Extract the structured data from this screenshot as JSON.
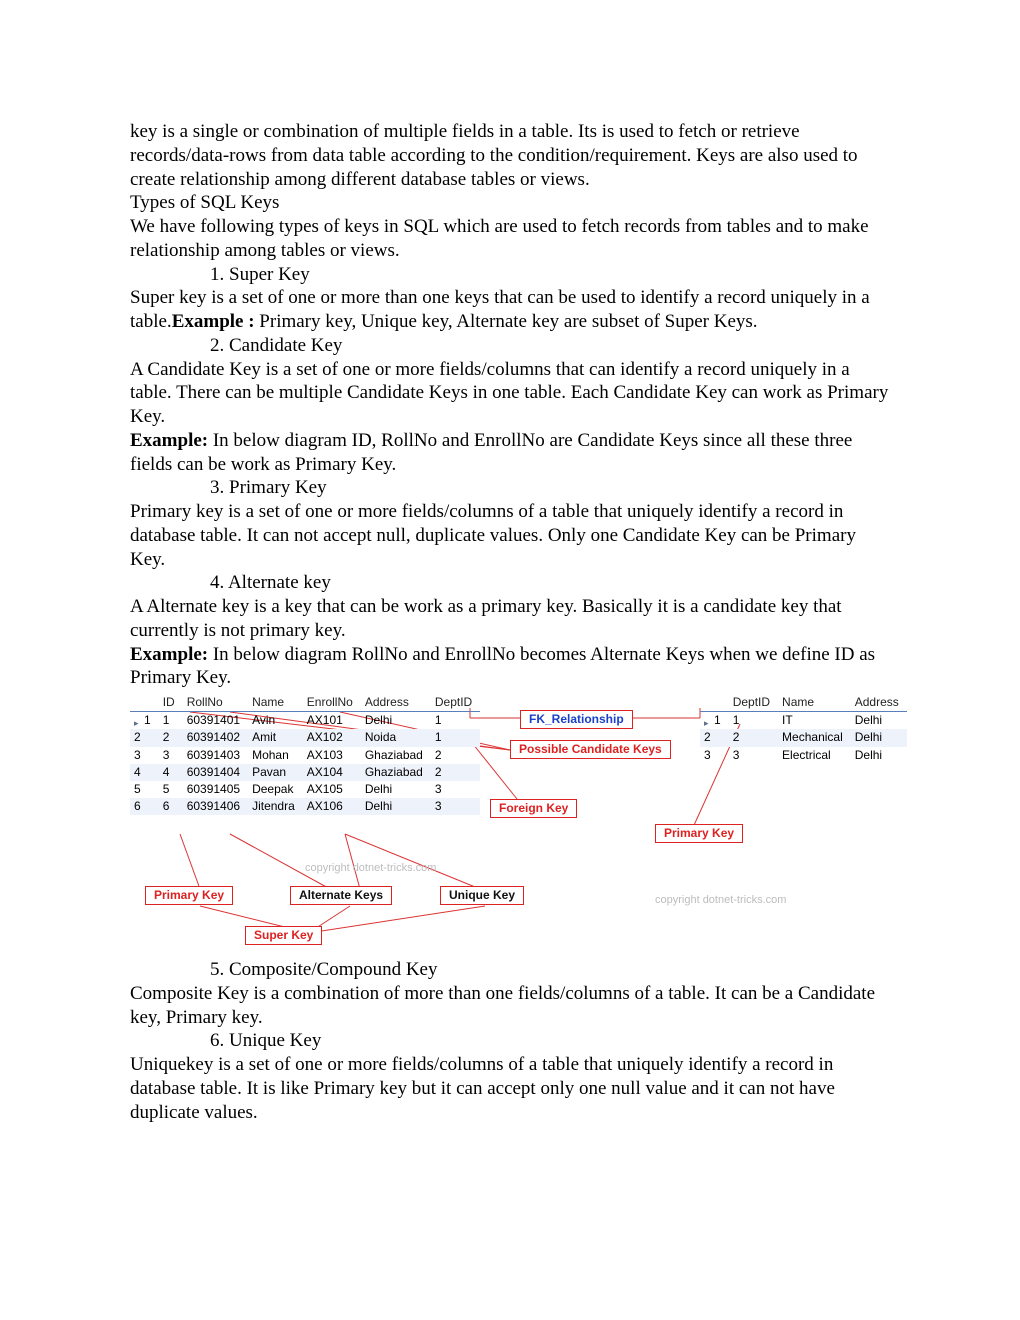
{
  "intro": "key is a single or combination of multiple fields in a table. Its is used to fetch or retrieve records/data-rows from data table according to the condition/requirement. Keys are also used to create relationship among different database tables or views.",
  "heading_types": "Types of SQL Keys",
  "types_intro": "We have following types of keys in SQL which are used to fetch records from tables and to make relationship among tables or views.",
  "items": {
    "superkey_title": "Super Key",
    "superkey_body_a": "Super key is a set of one or more than one keys that can be used to identify a record uniquely in a table.",
    "superkey_example_label": "Example :",
    "superkey_body_b": " Primary key, Unique key, Alternate key are subset of Super Keys.",
    "candidate_title": "Candidate Key",
    "candidate_body": "A Candidate Key is a set of one or more fields/columns that can identify a record uniquely in a table. There can be multiple Candidate Keys in one table. Each Candidate Key can work as Primary Key.",
    "candidate_example_label": "Example:",
    "candidate_example_body": " In below diagram ID, RollNo and EnrollNo are Candidate Keys since all these three fields can be work as Primary Key.",
    "primary_title": "Primary Key",
    "primary_body": "Primary key is a set of one or more fields/columns of a table that uniquely identify a record in database table. It can not accept null, duplicate values. Only one Candidate Key can be Primary Key.",
    "alternate_title": "Alternate key",
    "alternate_body": "A Alternate key is a key that can be work as a primary key. Basically it is a candidate key that currently is not primary key.",
    "alternate_example_label": "Example:",
    "alternate_example_body": " In below diagram RollNo and EnrollNo becomes Alternate Keys when we define ID as Primary Key.",
    "composite_title": "Composite/Compound Key",
    "composite_body": "Composite Key is a combination of more than one fields/columns of a table. It can be a Candidate key, Primary key.",
    "unique_title": "Unique Key",
    "unique_body": "Uniquekey is a set of one or more fields/columns of a table that uniquely identify a record in database table. It is like Primary key but it can accept only one null value and it can not have duplicate values."
  },
  "diagram": {
    "left_headers": [
      "",
      "ID",
      "RollNo",
      "Name",
      "EnrollNo",
      "Address",
      "DeptID"
    ],
    "left_rows": [
      [
        "1",
        "1",
        "60391401",
        "Avin",
        "AX101",
        "Delhi",
        "1"
      ],
      [
        "2",
        "2",
        "60391402",
        "Amit",
        "AX102",
        "Noida",
        "1"
      ],
      [
        "3",
        "3",
        "60391403",
        "Mohan",
        "AX103",
        "Ghaziabad",
        "2"
      ],
      [
        "4",
        "4",
        "60391404",
        "Pavan",
        "AX104",
        "Ghaziabad",
        "2"
      ],
      [
        "5",
        "5",
        "60391405",
        "Deepak",
        "AX105",
        "Delhi",
        "3"
      ],
      [
        "6",
        "6",
        "60391406",
        "Jitendra",
        "AX106",
        "Delhi",
        "3"
      ]
    ],
    "right_headers": [
      "",
      "DeptID",
      "Name",
      "Address"
    ],
    "right_rows": [
      [
        "1",
        "1",
        "IT",
        "Delhi"
      ],
      [
        "2",
        "2",
        "Mechanical",
        "Delhi"
      ],
      [
        "3",
        "3",
        "Electrical",
        "Delhi"
      ]
    ],
    "labels": {
      "fk_rel": "FK_Relationship",
      "possible": "Possible Candidate Keys",
      "foreign": "Foreign Key",
      "primary_right": "Primary Key",
      "primary_left": "Primary Key",
      "alternate": "Alternate Keys",
      "unique": "Unique Key",
      "superkey": "Super Key"
    },
    "watermark1": "copyright dotnet-tricks.com",
    "watermark2": "copyright dotnet-tricks.com"
  }
}
